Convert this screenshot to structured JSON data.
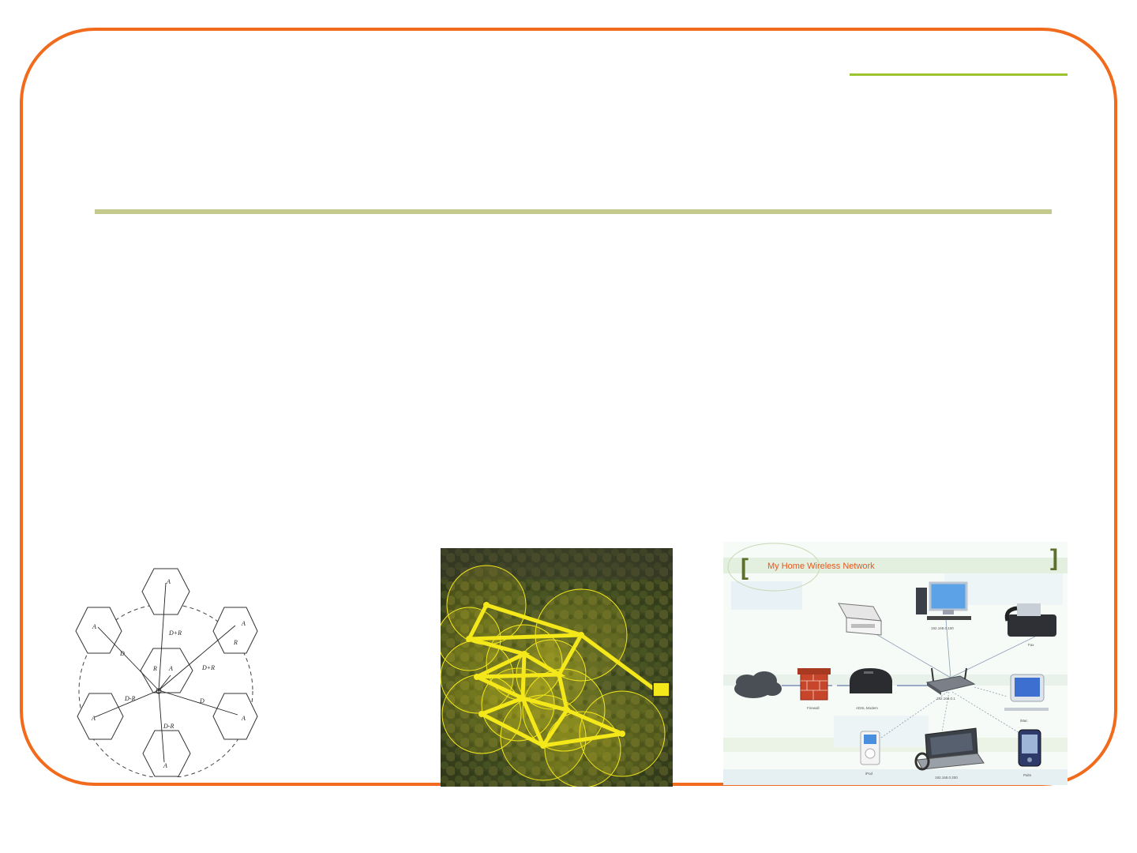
{
  "slide": {
    "accent_color": "#f26a1b",
    "line_color": "#9bc42f",
    "rule_color": "#c4c98e"
  },
  "hex_diagram": {
    "cell_labels": [
      "A",
      "A",
      "A",
      "A",
      "A",
      "A",
      "A"
    ],
    "center_cell_labels": [
      "R",
      "A"
    ],
    "distance_labels": [
      "D+R",
      "D+R",
      "D",
      "D-R",
      "D-R",
      "D",
      "R"
    ]
  },
  "mesh_image": {
    "node_color": "#f5e81a",
    "background": "aerial forest"
  },
  "network_diagram": {
    "title": "My Home Wireless Network",
    "devices": [
      {
        "icon": "printer-icon"
      },
      {
        "icon": "desktop-pc-icon",
        "caption": "192.168.0.100"
      },
      {
        "icon": "fax-icon",
        "caption": "Fax"
      },
      {
        "icon": "internet-cloud-icon"
      },
      {
        "icon": "firewall-icon",
        "caption": "Firewall"
      },
      {
        "icon": "adsl-modem-icon",
        "caption": "ADSL Modem"
      },
      {
        "icon": "wireless-router-icon",
        "caption": "192.168.0.1"
      },
      {
        "icon": "imac-icon",
        "caption": "iMac"
      },
      {
        "icon": "ipod-icon",
        "caption": "iPod"
      },
      {
        "icon": "laptop-icon",
        "caption": "192.168.0.200"
      },
      {
        "icon": "palm-icon",
        "caption": "Palm"
      }
    ]
  }
}
